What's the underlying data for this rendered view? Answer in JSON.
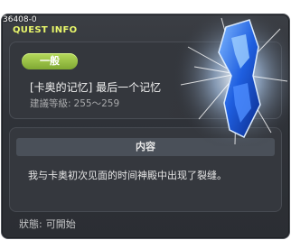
{
  "tooltip": {
    "quest_code": "36408-0",
    "section_label": "QUEST INFO",
    "badge": "一般",
    "title": "[卡奥的记忆] 最后一个记忆",
    "recommend_label": "建議等級:",
    "recommend_value": "255～259",
    "content_header": "内容",
    "content_text": "我与卡奥初次见面的时间神殿中出现了裂缝。",
    "status_label": "狀態:",
    "status_value": "可開始"
  },
  "colors": {
    "panel_bg": "#2f3238",
    "accent_yellow": "#e9f76b",
    "badge_green": "#9ac545",
    "crystal_blue": "#2a7bff"
  },
  "icons": [
    "crystal-icon"
  ]
}
